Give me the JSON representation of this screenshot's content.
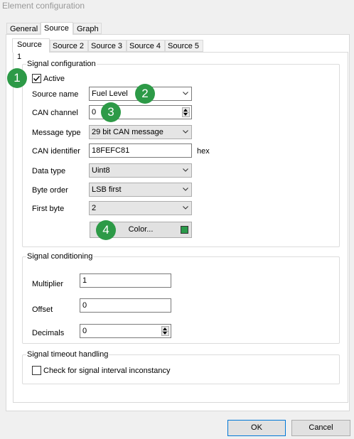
{
  "window": {
    "title": "Element configuration"
  },
  "tabs": [
    {
      "label": "General"
    },
    {
      "label": "Source"
    },
    {
      "label": "Graph"
    }
  ],
  "source_tabs": [
    {
      "label": "Source 1"
    },
    {
      "label": "Source 2"
    },
    {
      "label": "Source 3"
    },
    {
      "label": "Source 4"
    },
    {
      "label": "Source 5"
    }
  ],
  "signal_configuration": {
    "legend": "Signal configuration",
    "active_label": "Active",
    "active_checked": true,
    "source_name_label": "Source name",
    "source_name_value": "Fuel Level",
    "can_channel_label": "CAN channel",
    "can_channel_value": "0",
    "message_type_label": "Message type",
    "message_type_value": "29 bit CAN message",
    "can_identifier_label": "CAN identifier",
    "can_identifier_value": "18FEFC81",
    "hex_label": "hex",
    "data_type_label": "Data type",
    "data_type_value": "Uint8",
    "byte_order_label": "Byte order",
    "byte_order_value": "LSB first",
    "first_byte_label": "First byte",
    "first_byte_value": "2",
    "color_button_label": "Color...",
    "color_swatch": "#2a9a4a"
  },
  "signal_conditioning": {
    "legend": "Signal conditioning",
    "multiplier_label": "Multiplier",
    "multiplier_value": "1",
    "offset_label": "Offset",
    "offset_value": "0",
    "decimals_label": "Decimals",
    "decimals_value": "0"
  },
  "signal_timeout": {
    "legend": "Signal timeout handling",
    "check_label": "Check for signal interval inconstancy",
    "checked": false
  },
  "footer": {
    "ok_label": "OK",
    "cancel_label": "Cancel"
  },
  "annotations": [
    "1",
    "2",
    "3",
    "4"
  ],
  "colors": {
    "badge": "#2d9a47",
    "accent": "#0078d7"
  }
}
